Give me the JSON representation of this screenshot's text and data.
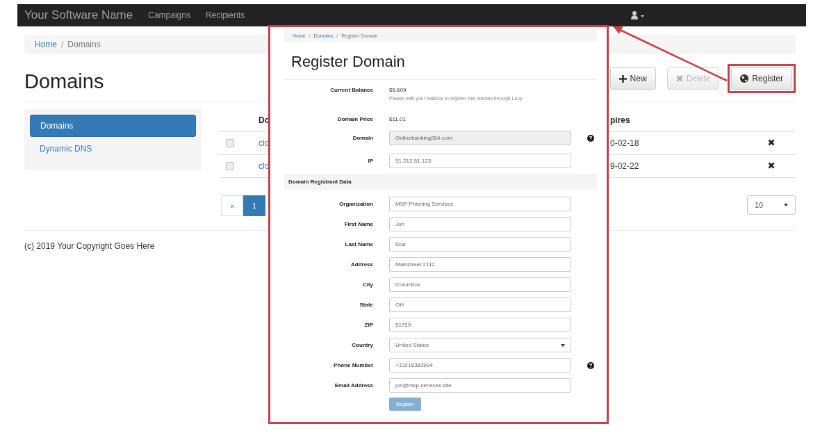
{
  "navbar": {
    "brand": "Your Software Name",
    "items": [
      "Campaigns",
      "Recipients"
    ]
  },
  "breadcrumb": {
    "separator": "/",
    "items": [
      "Home",
      "Domains"
    ]
  },
  "page_title": "Domains",
  "toolbar": [
    {
      "label": "New",
      "kind": "new",
      "disabled": false,
      "highlighted": false
    },
    {
      "label": "Delete",
      "kind": "delete",
      "disabled": true,
      "highlighted": false
    },
    {
      "label": "Register",
      "kind": "register",
      "disabled": false,
      "highlighted": true
    }
  ],
  "sidebar": {
    "items": [
      {
        "label": "Domains",
        "selected": true
      },
      {
        "label": "Dynamic DNS",
        "selected": false
      }
    ]
  },
  "table": {
    "columns": [
      "Do",
      "pires"
    ],
    "rows": [
      {
        "checked": false,
        "column_1": "clo",
        "column_2": "0-02-18"
      },
      {
        "checked": false,
        "column_1": "clo",
        "column_2": "9-02-22"
      }
    ]
  },
  "pagination": [
    {
      "label": "«",
      "selected": false
    },
    {
      "label": "1",
      "selected": true
    }
  ],
  "page_size": "10",
  "footer": "(c) 2019 Your Copyright Goes Here",
  "overlay": {
    "breadcrumb": {
      "separator": "/",
      "items": [
        "Home",
        "Domains",
        "Register Domain"
      ]
    },
    "title": "Register Domain",
    "balance_label": "Current Balance",
    "balance": "$5.609",
    "balance_note": "Please refill your balance to register this domain through Lucy",
    "price_label": "Domain Price",
    "price": "$11.01",
    "fields": [
      {
        "label": "Domain",
        "value": "Onlinebanking264.com",
        "disabled": true,
        "help": true
      },
      {
        "label": "IP",
        "value": "51.212.51.123",
        "disabled": false,
        "help": false
      }
    ],
    "section": "Domain Registrant Data",
    "registrant_fields": [
      {
        "label": "Organization",
        "value": "MSP Phishing Services",
        "kind": "text",
        "help": false
      },
      {
        "label": "First Name",
        "value": "Jon",
        "kind": "text",
        "help": false
      },
      {
        "label": "Last Name",
        "value": "Doe",
        "kind": "text",
        "help": false
      },
      {
        "label": "Address",
        "value": "Mainstreet 2112",
        "kind": "text",
        "help": false
      },
      {
        "label": "City",
        "value": "Columbus",
        "kind": "text",
        "help": false
      },
      {
        "label": "State",
        "value": "OH",
        "kind": "text",
        "help": false
      },
      {
        "label": "ZIP",
        "value": "51729",
        "kind": "text",
        "help": false
      },
      {
        "label": "Country",
        "value": "United States",
        "kind": "select",
        "help": false
      },
      {
        "label": "Phone Number",
        "value": "+13218383994",
        "kind": "text",
        "help": true
      },
      {
        "label": "Email Address",
        "value": "jon@msp-services.site",
        "kind": "text",
        "help": false
      }
    ],
    "submit": {
      "label": "Register",
      "disabled": true
    }
  }
}
